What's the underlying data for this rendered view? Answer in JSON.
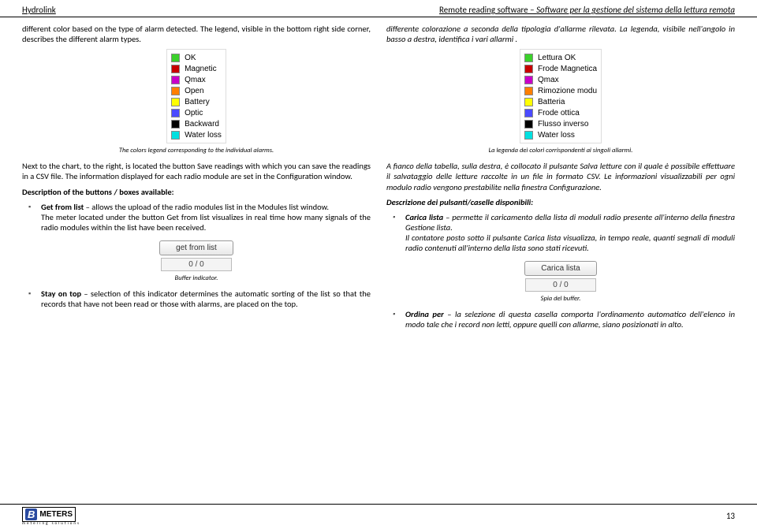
{
  "header": {
    "left": "Hydrolink",
    "right_plain": "Remote reading software – ",
    "right_italic": "Software per la gestione del sistema della lettura remota"
  },
  "left": {
    "p1": "different color based on the type of alarm detected. The legend, visible in the bottom right side corner, describes the different alarm types.",
    "legend": [
      {
        "color": "#3bd12b",
        "label": "OK"
      },
      {
        "color": "#c80000",
        "label": "Magnetic"
      },
      {
        "color": "#c800c8",
        "label": "Qmax"
      },
      {
        "color": "#ff7f00",
        "label": "Open"
      },
      {
        "color": "#ffff00",
        "label": "Battery"
      },
      {
        "color": "#4a4aff",
        "label": "Optic"
      },
      {
        "color": "#000000",
        "label": "Backward"
      },
      {
        "color": "#00e0e0",
        "label": "Water loss"
      }
    ],
    "cap1": "The colors legend corresponding to the individual alarms.",
    "p2": "Next to the chart, to the right, is located the button Save readings with which you can save the readings in a CSV file. The information displayed for each radio module are set in the Configuration window.",
    "h2": "Description of the buttons / boxes available:",
    "b1a_lbl": "Get from list",
    "b1a_txt": " – allows the upload of the radio modules list in the Modules list window.",
    "b1b": "The meter located under the button Get from list visualizes in real time how many signals of the radio modules within the list have been received.",
    "btn1": "get from list",
    "counter": "0 / 0",
    "cap2": "Buffer indicator.",
    "b2_lbl": "Stay on top",
    "b2_txt": " – selection of this indicator determines the automatic sorting of the list so that the records that have not been read or those with alarms, are placed on the top."
  },
  "right": {
    "p1": "differente colorazione a seconda della tipologia d'allarme rilevata. La legenda, visibile nell'angolo in basso a destra, identifica i vari allarmi .",
    "legend": [
      {
        "color": "#3bd12b",
        "label": "Lettura OK"
      },
      {
        "color": "#c80000",
        "label": "Frode Magnetica"
      },
      {
        "color": "#c800c8",
        "label": "Qmax"
      },
      {
        "color": "#ff7f00",
        "label": "Rimozione modu"
      },
      {
        "color": "#ffff00",
        "label": "Batteria"
      },
      {
        "color": "#4a4aff",
        "label": "Frode ottica"
      },
      {
        "color": "#000000",
        "label": "Flusso inverso"
      },
      {
        "color": "#00e0e0",
        "label": "Water loss"
      }
    ],
    "cap1": "La legenda dei colori corrispondenti ai singoli allarmi.",
    "p2": "A fianco della tabella, sulla destra, è collocato il pulsante Salva letture con il quale è possibile effettuare il salvataggio delle letture raccolte in un file in formato CSV. Le informazioni visualizzabili per ogni modulo radio vengono prestabilite nella finestra Configurazione.",
    "h2": "Descrizione dei pulsanti/caselle disponibili:",
    "b1a_lbl": "Carica lista",
    "b1a_txt": " – permette il caricamento della lista di moduli radio presente all'interno della finestra Gestione lista.",
    "b1b": "Il contatore posto sotto il pulsante Carica lista visualizza, in tempo reale, quanti segnali di moduli radio contenuti all'interno della lista sono stati ricevuti.",
    "btn1": "Carica lista",
    "counter": "0 / 0",
    "cap2": "Spia del buffer.",
    "b2_lbl": "Ordina per",
    "b2_txt": " – la selezione di questa casella comporta l'ordinamento automatico dell'elenco in modo tale che i record non letti, oppure quelli con allarme, siano posizionati in alto."
  },
  "footer": {
    "brand": "METERS",
    "sub": "metering solutions",
    "page": "13"
  }
}
